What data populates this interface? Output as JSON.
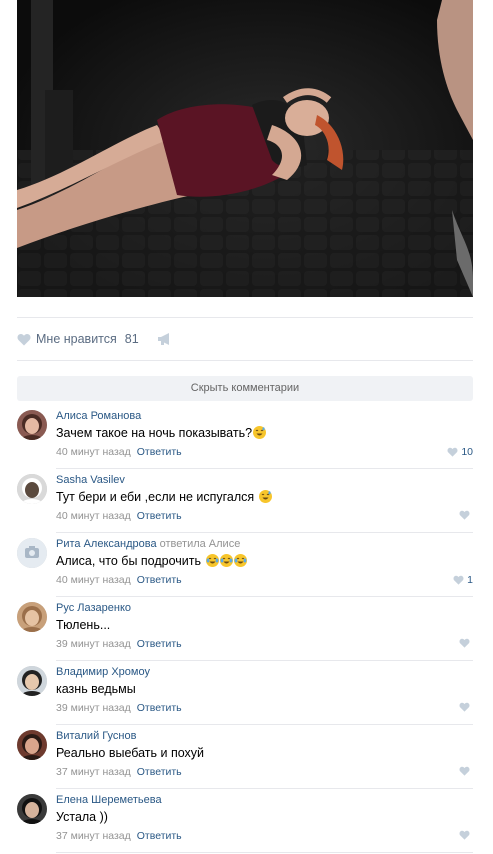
{
  "post": {
    "likes_label": "Мне нравится",
    "likes_count": "81",
    "hide_comments_label": "Скрыть комментарии"
  },
  "colors": {
    "link": "#2a5885",
    "meta": "#939393",
    "divider": "#e7e8ec",
    "hide_bar_bg": "#f0f2f5"
  },
  "comments": [
    {
      "author": "Алиса Романова",
      "reply_to": "",
      "text": "Зачем такое на ночь показывать?",
      "emoji": [
        "sweat-smile"
      ],
      "time": "40 минут назад",
      "reply_label": "Ответить",
      "likes": "10"
    },
    {
      "author": "Sasha Vasilev",
      "reply_to": "",
      "text": "Тут бери и еби ,если не испугался",
      "emoji": [
        "sweat-smile"
      ],
      "time": "40 минут назад",
      "reply_label": "Ответить",
      "likes": ""
    },
    {
      "author": "Рита Александрова",
      "reply_to": "ответила Алисе",
      "text": "Алиса, что бы подрочить",
      "emoji": [
        "joy",
        "joy",
        "joy"
      ],
      "time": "40 минут назад",
      "reply_label": "Ответить",
      "likes": "1"
    },
    {
      "author": "Рус Лазаренко",
      "reply_to": "",
      "text": "Тюлень...",
      "emoji": [],
      "time": "39 минут назад",
      "reply_label": "Ответить",
      "likes": ""
    },
    {
      "author": "Владимир Хромоу",
      "reply_to": "",
      "text": "казнь ведьмы",
      "emoji": [],
      "time": "39 минут назад",
      "reply_label": "Ответить",
      "likes": ""
    },
    {
      "author": "Виталий Гуснов",
      "reply_to": "",
      "text": "Реально выебать и похуй",
      "emoji": [],
      "time": "37 минут назад",
      "reply_label": "Ответить",
      "likes": ""
    },
    {
      "author": "Елена Шереметьева",
      "reply_to": "",
      "text": "Устала ))",
      "emoji": [],
      "time": "37 минут назад",
      "reply_label": "Ответить",
      "likes": ""
    }
  ]
}
